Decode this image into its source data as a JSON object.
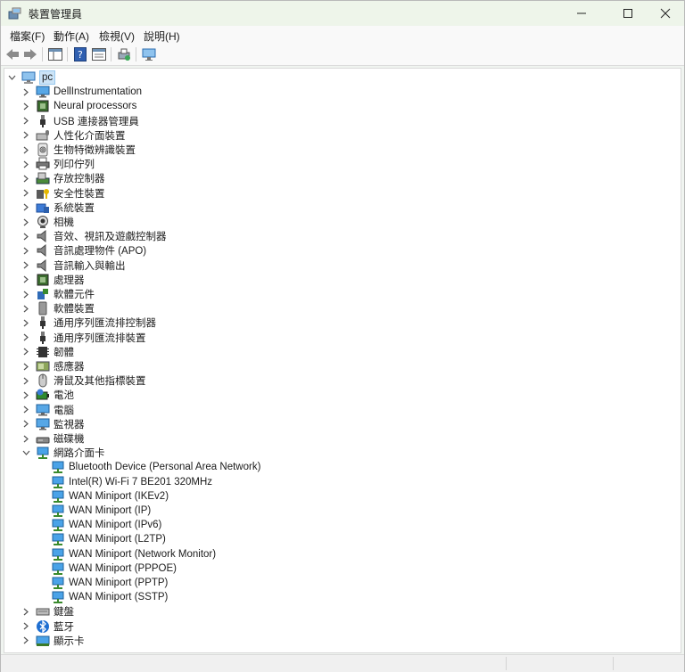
{
  "window": {
    "title": "裝置管理員",
    "min": "—",
    "max": "☐",
    "close": "✕"
  },
  "menu": [
    "檔案(F)",
    "動作(A)",
    "檢視(V)",
    "說明(H)"
  ],
  "tree": {
    "root": "pc",
    "categories": [
      {
        "label": "DellInstrumentation",
        "icon": "monitor-icon"
      },
      {
        "label": "Neural processors",
        "icon": "chip-icon"
      },
      {
        "label": "USB 連接器管理員",
        "icon": "usb-icon"
      },
      {
        "label": "人性化介面裝置",
        "icon": "keyboard-mouse-icon"
      },
      {
        "label": "生物特徵辨識裝置",
        "icon": "fingerprint-icon"
      },
      {
        "label": "列印佇列",
        "icon": "printer-icon"
      },
      {
        "label": "存放控制器",
        "icon": "storage-controller-icon"
      },
      {
        "label": "安全性裝置",
        "icon": "security-key-icon"
      },
      {
        "label": "系統裝置",
        "icon": "system-folder-icon"
      },
      {
        "label": "相機",
        "icon": "camera-icon"
      },
      {
        "label": "音效、視訊及遊戲控制器",
        "icon": "speaker-icon"
      },
      {
        "label": "音訊處理物件 (APO)",
        "icon": "speaker-icon"
      },
      {
        "label": "音訊輸入與輸出",
        "icon": "speaker-icon"
      },
      {
        "label": "處理器",
        "icon": "chip-icon"
      },
      {
        "label": "軟體元件",
        "icon": "puzzle-icon"
      },
      {
        "label": "軟體裝置",
        "icon": "device-icon"
      },
      {
        "label": "通用序列匯流排控制器",
        "icon": "usb-icon"
      },
      {
        "label": "通用序列匯流排裝置",
        "icon": "usb-icon"
      },
      {
        "label": "韌體",
        "icon": "firmware-icon"
      },
      {
        "label": "感應器",
        "icon": "sensor-icon"
      },
      {
        "label": "滑鼠及其他指標裝置",
        "icon": "mouse-icon"
      },
      {
        "label": "電池",
        "icon": "battery-icon"
      },
      {
        "label": "電腦",
        "icon": "computer-icon"
      },
      {
        "label": "監視器",
        "icon": "monitor-icon"
      },
      {
        "label": "磁碟機",
        "icon": "disk-drive-icon"
      },
      {
        "label": "網路介面卡",
        "icon": "network-adapter-icon",
        "expanded": true
      },
      {
        "label": "鍵盤",
        "icon": "keyboard-icon"
      },
      {
        "label": "藍牙",
        "icon": "bluetooth-icon"
      },
      {
        "label": "顯示卡",
        "icon": "display-adapter-icon"
      }
    ],
    "network_adapters": [
      "Bluetooth Device (Personal Area Network)",
      "Intel(R) Wi-Fi 7 BE201 320MHz",
      "WAN Miniport (IKEv2)",
      "WAN Miniport (IP)",
      "WAN Miniport (IPv6)",
      "WAN Miniport (L2TP)",
      "WAN Miniport (Network Monitor)",
      "WAN Miniport (PPPOE)",
      "WAN Miniport (PPTP)",
      "WAN Miniport (SSTP)"
    ]
  }
}
